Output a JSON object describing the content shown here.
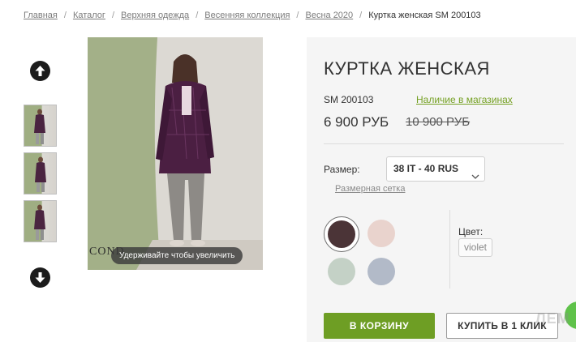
{
  "breadcrumb": {
    "items": [
      "Главная",
      "Каталог",
      "Верхняя одежда",
      "Весенняя коллекция",
      "Весна 2020"
    ],
    "current": "Куртка женская SM 200103",
    "separator": "/"
  },
  "gallery": {
    "up_icon": "arrow-up-circle-icon",
    "down_icon": "arrow-down-circle-icon",
    "zoom_hint": "Удерживайте чтобы увеличить",
    "brand": "COND"
  },
  "product": {
    "title": "КУРТКА ЖЕНСКАЯ",
    "sku": "SM 200103",
    "availability": "Наличие в магазинах",
    "price": "6 900 РУБ",
    "old_price": "10 900 РУБ",
    "size_label": "Размер:",
    "size_value": "38 IT - 40 RUS",
    "size_chart": "Размерная сетка",
    "color_label": "Цвет:",
    "color_value": "violet",
    "swatch_colors": [
      "#4b3437",
      "#e9d3cd",
      "#c4d1c6",
      "#b2bac8"
    ],
    "add_to_cart": "В КОРЗИНУ",
    "buy_one_click": "КУПИТЬ В 1 КЛИК",
    "accent_color": "#6e9e24"
  },
  "watermark": "ЛЕМ"
}
